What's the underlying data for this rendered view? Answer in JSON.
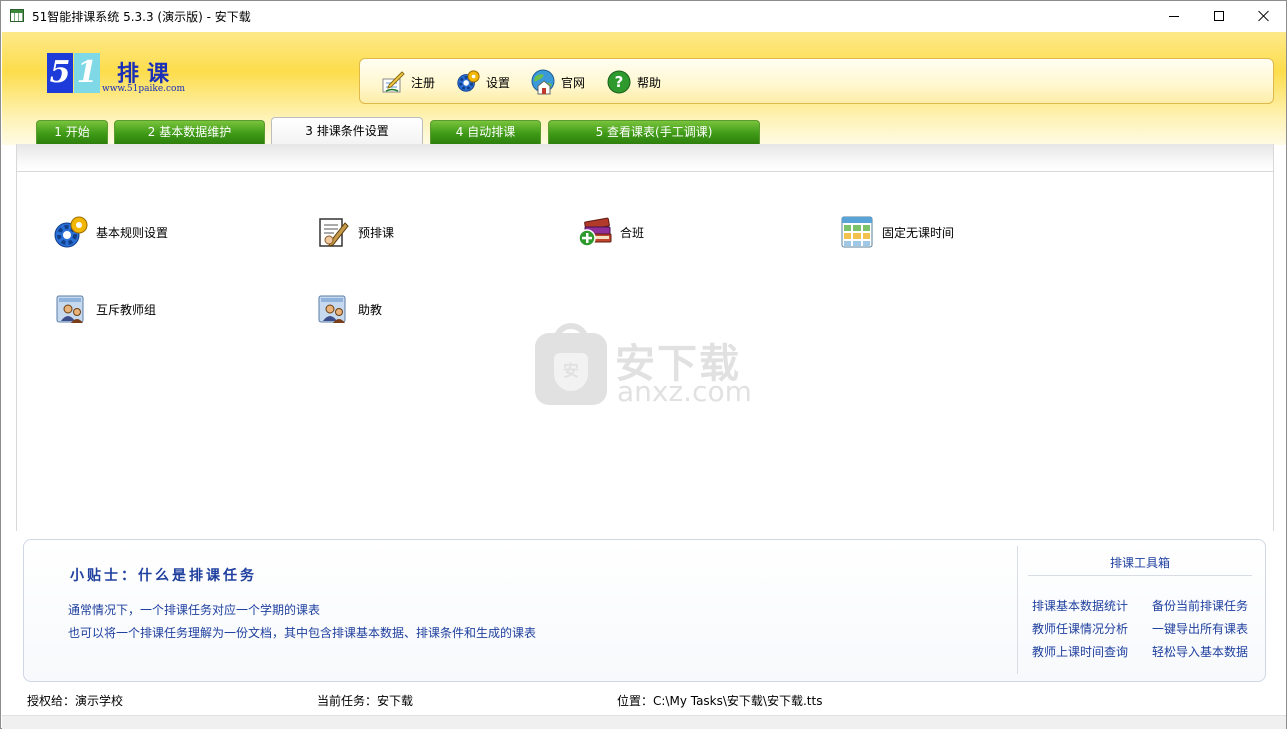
{
  "window": {
    "title": "51智能排课系统 5.3.3 (演示版) - 安下载",
    "controls": {
      "minimize": "minimize-icon",
      "maximize": "maximize-icon",
      "close": "close-icon"
    }
  },
  "logo": {
    "digit1": "5",
    "digit2": "1",
    "title": "排课",
    "url": "www.51paike.com"
  },
  "toolbar": {
    "register": "注册",
    "settings": "设置",
    "website": "官网",
    "help": "帮助"
  },
  "tabs": [
    {
      "label": "1 开始",
      "active": false
    },
    {
      "label": "2 基本数据维护",
      "active": false
    },
    {
      "label": "3 排课条件设置",
      "active": true
    },
    {
      "label": "4 自动排课",
      "active": false
    },
    {
      "label": "5 查看课表(手工调课)",
      "active": false
    }
  ],
  "functions": [
    {
      "label": "基本规则设置",
      "icon": "gear-icon"
    },
    {
      "label": "预排课",
      "icon": "edit-document-icon"
    },
    {
      "label": "合班",
      "icon": "books-add-icon"
    },
    {
      "label": "固定无课时间",
      "icon": "grid-table-icon"
    },
    {
      "label": "互斥教师组",
      "icon": "teacher-group-icon"
    },
    {
      "label": "助教",
      "icon": "assistant-icon"
    }
  ],
  "watermark": {
    "cn": "安下载",
    "en": "anxz.com",
    "badge": "安"
  },
  "tip": {
    "title": "小贴士：什么是排课任务",
    "lines": [
      "通常情况下，一个排课任务对应一个学期的课表",
      "也可以将一个排课任务理解为一份文档，其中包含排课基本数据、排课条件和生成的课表"
    ]
  },
  "toolbox": {
    "title": "排课工具箱",
    "links": [
      "排课基本数据统计",
      "备份当前排课任务",
      "教师任课情况分析",
      "一键导出所有课表",
      "教师上课时间查询",
      "轻松导入基本数据"
    ]
  },
  "status": {
    "license": "授权给：演示学校",
    "task": "当前任务：安下载",
    "location": "位置：C:\\My Tasks\\安下载\\安下载.tts"
  },
  "colors": {
    "accent_blue": "#1e3f9e",
    "tab_green": "#3f9a17",
    "header_yellow": "#fddd4c"
  }
}
